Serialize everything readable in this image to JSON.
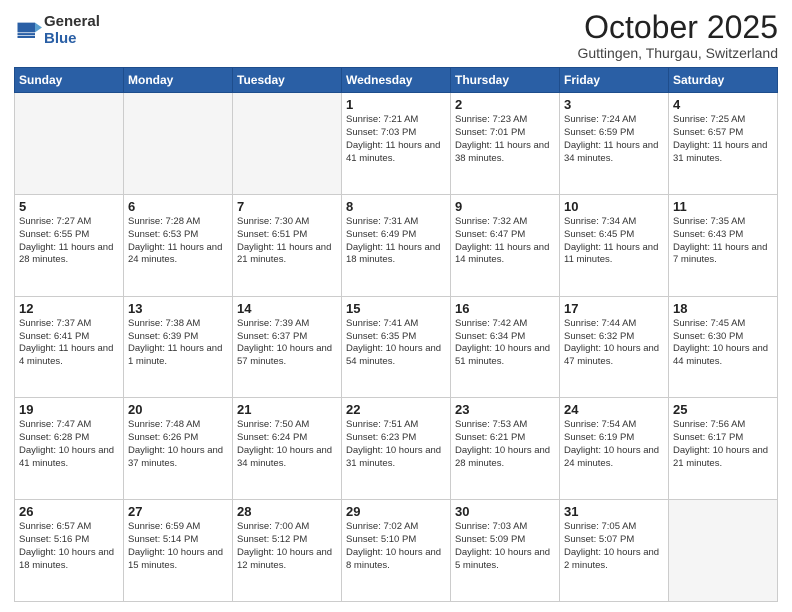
{
  "logo": {
    "general": "General",
    "blue": "Blue"
  },
  "header": {
    "month": "October 2025",
    "location": "Guttingen, Thurgau, Switzerland"
  },
  "days_of_week": [
    "Sunday",
    "Monday",
    "Tuesday",
    "Wednesday",
    "Thursday",
    "Friday",
    "Saturday"
  ],
  "weeks": [
    [
      {
        "day": "",
        "info": ""
      },
      {
        "day": "",
        "info": ""
      },
      {
        "day": "",
        "info": ""
      },
      {
        "day": "1",
        "info": "Sunrise: 7:21 AM\nSunset: 7:03 PM\nDaylight: 11 hours\nand 41 minutes."
      },
      {
        "day": "2",
        "info": "Sunrise: 7:23 AM\nSunset: 7:01 PM\nDaylight: 11 hours\nand 38 minutes."
      },
      {
        "day": "3",
        "info": "Sunrise: 7:24 AM\nSunset: 6:59 PM\nDaylight: 11 hours\nand 34 minutes."
      },
      {
        "day": "4",
        "info": "Sunrise: 7:25 AM\nSunset: 6:57 PM\nDaylight: 11 hours\nand 31 minutes."
      }
    ],
    [
      {
        "day": "5",
        "info": "Sunrise: 7:27 AM\nSunset: 6:55 PM\nDaylight: 11 hours\nand 28 minutes."
      },
      {
        "day": "6",
        "info": "Sunrise: 7:28 AM\nSunset: 6:53 PM\nDaylight: 11 hours\nand 24 minutes."
      },
      {
        "day": "7",
        "info": "Sunrise: 7:30 AM\nSunset: 6:51 PM\nDaylight: 11 hours\nand 21 minutes."
      },
      {
        "day": "8",
        "info": "Sunrise: 7:31 AM\nSunset: 6:49 PM\nDaylight: 11 hours\nand 18 minutes."
      },
      {
        "day": "9",
        "info": "Sunrise: 7:32 AM\nSunset: 6:47 PM\nDaylight: 11 hours\nand 14 minutes."
      },
      {
        "day": "10",
        "info": "Sunrise: 7:34 AM\nSunset: 6:45 PM\nDaylight: 11 hours\nand 11 minutes."
      },
      {
        "day": "11",
        "info": "Sunrise: 7:35 AM\nSunset: 6:43 PM\nDaylight: 11 hours\nand 7 minutes."
      }
    ],
    [
      {
        "day": "12",
        "info": "Sunrise: 7:37 AM\nSunset: 6:41 PM\nDaylight: 11 hours\nand 4 minutes."
      },
      {
        "day": "13",
        "info": "Sunrise: 7:38 AM\nSunset: 6:39 PM\nDaylight: 11 hours\nand 1 minute."
      },
      {
        "day": "14",
        "info": "Sunrise: 7:39 AM\nSunset: 6:37 PM\nDaylight: 10 hours\nand 57 minutes."
      },
      {
        "day": "15",
        "info": "Sunrise: 7:41 AM\nSunset: 6:35 PM\nDaylight: 10 hours\nand 54 minutes."
      },
      {
        "day": "16",
        "info": "Sunrise: 7:42 AM\nSunset: 6:34 PM\nDaylight: 10 hours\nand 51 minutes."
      },
      {
        "day": "17",
        "info": "Sunrise: 7:44 AM\nSunset: 6:32 PM\nDaylight: 10 hours\nand 47 minutes."
      },
      {
        "day": "18",
        "info": "Sunrise: 7:45 AM\nSunset: 6:30 PM\nDaylight: 10 hours\nand 44 minutes."
      }
    ],
    [
      {
        "day": "19",
        "info": "Sunrise: 7:47 AM\nSunset: 6:28 PM\nDaylight: 10 hours\nand 41 minutes."
      },
      {
        "day": "20",
        "info": "Sunrise: 7:48 AM\nSunset: 6:26 PM\nDaylight: 10 hours\nand 37 minutes."
      },
      {
        "day": "21",
        "info": "Sunrise: 7:50 AM\nSunset: 6:24 PM\nDaylight: 10 hours\nand 34 minutes."
      },
      {
        "day": "22",
        "info": "Sunrise: 7:51 AM\nSunset: 6:23 PM\nDaylight: 10 hours\nand 31 minutes."
      },
      {
        "day": "23",
        "info": "Sunrise: 7:53 AM\nSunset: 6:21 PM\nDaylight: 10 hours\nand 28 minutes."
      },
      {
        "day": "24",
        "info": "Sunrise: 7:54 AM\nSunset: 6:19 PM\nDaylight: 10 hours\nand 24 minutes."
      },
      {
        "day": "25",
        "info": "Sunrise: 7:56 AM\nSunset: 6:17 PM\nDaylight: 10 hours\nand 21 minutes."
      }
    ],
    [
      {
        "day": "26",
        "info": "Sunrise: 6:57 AM\nSunset: 5:16 PM\nDaylight: 10 hours\nand 18 minutes."
      },
      {
        "day": "27",
        "info": "Sunrise: 6:59 AM\nSunset: 5:14 PM\nDaylight: 10 hours\nand 15 minutes."
      },
      {
        "day": "28",
        "info": "Sunrise: 7:00 AM\nSunset: 5:12 PM\nDaylight: 10 hours\nand 12 minutes."
      },
      {
        "day": "29",
        "info": "Sunrise: 7:02 AM\nSunset: 5:10 PM\nDaylight: 10 hours\nand 8 minutes."
      },
      {
        "day": "30",
        "info": "Sunrise: 7:03 AM\nSunset: 5:09 PM\nDaylight: 10 hours\nand 5 minutes."
      },
      {
        "day": "31",
        "info": "Sunrise: 7:05 AM\nSunset: 5:07 PM\nDaylight: 10 hours\nand 2 minutes."
      },
      {
        "day": "",
        "info": ""
      }
    ]
  ]
}
